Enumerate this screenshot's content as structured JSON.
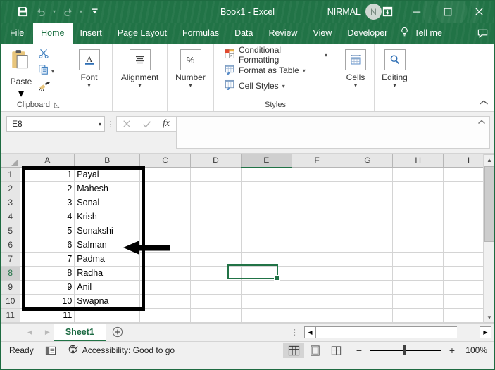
{
  "window": {
    "title": "Book1  -  Excel",
    "account_name": "NIRMAL",
    "avatar_initial": "N",
    "quick_access": [
      {
        "name": "save",
        "icon": "save-icon"
      },
      {
        "name": "undo",
        "icon": "undo-icon"
      },
      {
        "name": "redo",
        "icon": "redo-icon"
      },
      {
        "name": "customize",
        "icon": "customize-qat-icon"
      }
    ],
    "controls": {
      "ribbon_display": "Ribbon Display Options",
      "minimize": "Minimize",
      "maximize": "Restore Down",
      "close": "Close"
    }
  },
  "ribbon": {
    "tabs": [
      {
        "label": "File",
        "active": false
      },
      {
        "label": "Home",
        "active": true
      },
      {
        "label": "Insert",
        "active": false
      },
      {
        "label": "Page Layout",
        "active": false
      },
      {
        "label": "Formulas",
        "active": false
      },
      {
        "label": "Data",
        "active": false
      },
      {
        "label": "Review",
        "active": false
      },
      {
        "label": "View",
        "active": false
      },
      {
        "label": "Developer",
        "active": false
      }
    ],
    "tell_me": "Tell me",
    "groups": {
      "clipboard": {
        "label": "Clipboard",
        "paste_label": "Paste",
        "cut": "Cut",
        "copy": "Copy",
        "format_painter": "Format Painter"
      },
      "font": {
        "label": "Font"
      },
      "alignment": {
        "label": "Alignment"
      },
      "number": {
        "label": "Number",
        "symbol": "%"
      },
      "styles": {
        "label": "Styles",
        "items": [
          "Conditional Formatting",
          "Format as Table",
          "Cell Styles"
        ]
      },
      "cells": {
        "label": "Cells"
      },
      "editing": {
        "label": "Editing"
      }
    }
  },
  "formula_bar": {
    "name_box_value": "E8",
    "cancel": "Cancel",
    "enter": "Enter",
    "insert_function": "fx",
    "formula_value": "",
    "expand": "Expand Formula Bar"
  },
  "grid": {
    "columns": [
      "A",
      "B",
      "C",
      "D",
      "E",
      "F",
      "G",
      "H",
      "I"
    ],
    "selected_column": "E",
    "rows": [
      1,
      2,
      3,
      4,
      5,
      6,
      7,
      8,
      9,
      10,
      11
    ],
    "selected_row": 8,
    "selected_cell": "E8",
    "data": [
      {
        "row": 1,
        "A": "1",
        "B": "Payal"
      },
      {
        "row": 2,
        "A": "2",
        "B": "Mahesh"
      },
      {
        "row": 3,
        "A": "3",
        "B": "Sonal"
      },
      {
        "row": 4,
        "A": "4",
        "B": "Krish"
      },
      {
        "row": 5,
        "A": "5",
        "B": "Sonakshi"
      },
      {
        "row": 6,
        "A": "6",
        "B": "Salman"
      },
      {
        "row": 7,
        "A": "7",
        "B": "Padma"
      },
      {
        "row": 8,
        "A": "8",
        "B": "Radha"
      },
      {
        "row": 9,
        "A": "9",
        "B": "Anil"
      },
      {
        "row": 10,
        "A": "10",
        "B": "Swapna"
      },
      {
        "row": 11,
        "A": "11",
        "B": ""
      }
    ],
    "annotations": {
      "highlight_range": "A1:B10",
      "arrow_points_at_row": 6
    }
  },
  "sheet_bar": {
    "tabs": [
      {
        "label": "Sheet1",
        "active": true
      }
    ],
    "add_sheet": "New sheet",
    "prev": "Previous sheet",
    "next": "Next sheet"
  },
  "status_bar": {
    "mode": "Ready",
    "accessibility": "Accessibility: Good to go",
    "views": [
      {
        "name": "normal-view",
        "active": true
      },
      {
        "name": "page-layout-view",
        "active": false
      },
      {
        "name": "page-break-preview",
        "active": false
      }
    ],
    "zoom_percent": "100%",
    "zoom_out": "Zoom Out",
    "zoom_in": "Zoom In"
  },
  "colors": {
    "brand_green": "#217346",
    "accent_selection": "#217346",
    "annotation_black": "#000000"
  }
}
